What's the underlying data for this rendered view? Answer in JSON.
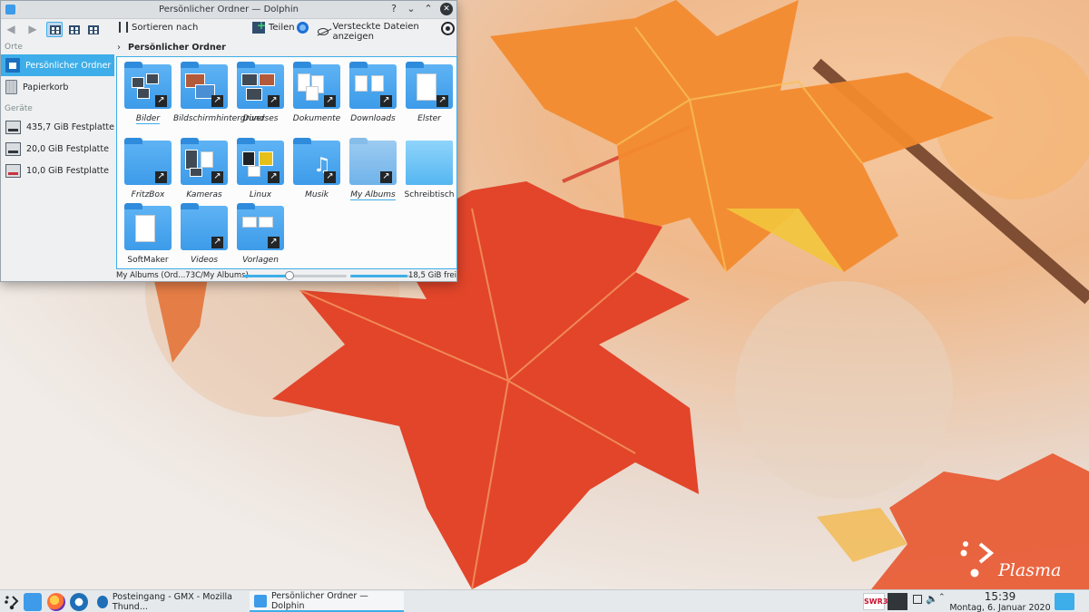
{
  "window": {
    "title": "Persönlicher Ordner — Dolphin",
    "help": "?",
    "minimize": "⌄",
    "maximize": "⌃",
    "close": "✕"
  },
  "toolbar": {
    "sort_label": "Sortieren nach",
    "share_label": "Teilen",
    "hidden_files_label": "Versteckte Dateien anzeigen"
  },
  "sidebar": {
    "places_heading": "Orte",
    "places": [
      {
        "label": "Persönlicher Ordner",
        "icon": "home-icon"
      },
      {
        "label": "Papierkorb",
        "icon": "trash-icon"
      }
    ],
    "devices_heading": "Geräte",
    "devices": [
      {
        "label": "435,7 GiB Festplatte",
        "icon": "disk-icon"
      },
      {
        "label": "20,0 GiB Festplatte",
        "icon": "disk-icon"
      },
      {
        "label": "10,0 GiB Festplatte",
        "icon": "disk-icon"
      }
    ]
  },
  "breadcrumb": {
    "arrow": "›",
    "current": "Persönlicher Ordner"
  },
  "folders": [
    {
      "label": "Bilder"
    },
    {
      "label": "Bildschirmhintergrund"
    },
    {
      "label": "Diverses"
    },
    {
      "label": "Dokumente"
    },
    {
      "label": "Downloads"
    },
    {
      "label": "Elster"
    },
    {
      "label": "FritzBox"
    },
    {
      "label": "Kameras"
    },
    {
      "label": "Linux"
    },
    {
      "label": "Musik"
    },
    {
      "label": "My Albums"
    },
    {
      "label": "Schreibtisch"
    },
    {
      "label": "SoftMaker"
    },
    {
      "label": "Videos"
    },
    {
      "label": "Vorlagen"
    }
  ],
  "statusbar": {
    "selection_text": "My Albums (Ord...73C/My Albums)",
    "zoom_level_fraction": 0.45,
    "used_space_fraction": 0.95,
    "free_space_text": "18,5 GiB frei"
  },
  "taskbar": {
    "tasks": [
      {
        "label": "Posteingang - GMX - Mozilla Thund..."
      },
      {
        "label": "Persönlicher Ordner — Dolphin"
      }
    ],
    "tray_radio": "SWR3",
    "time": "15:39",
    "date": "Montag, 6. Januar 2020"
  },
  "desktop": {
    "logo_text": "Plasma"
  },
  "colors": {
    "accent": "#3daee9",
    "folder": "#3d9be9",
    "leaf_red": "#e2452a",
    "leaf_orange": "#f28a2e"
  }
}
